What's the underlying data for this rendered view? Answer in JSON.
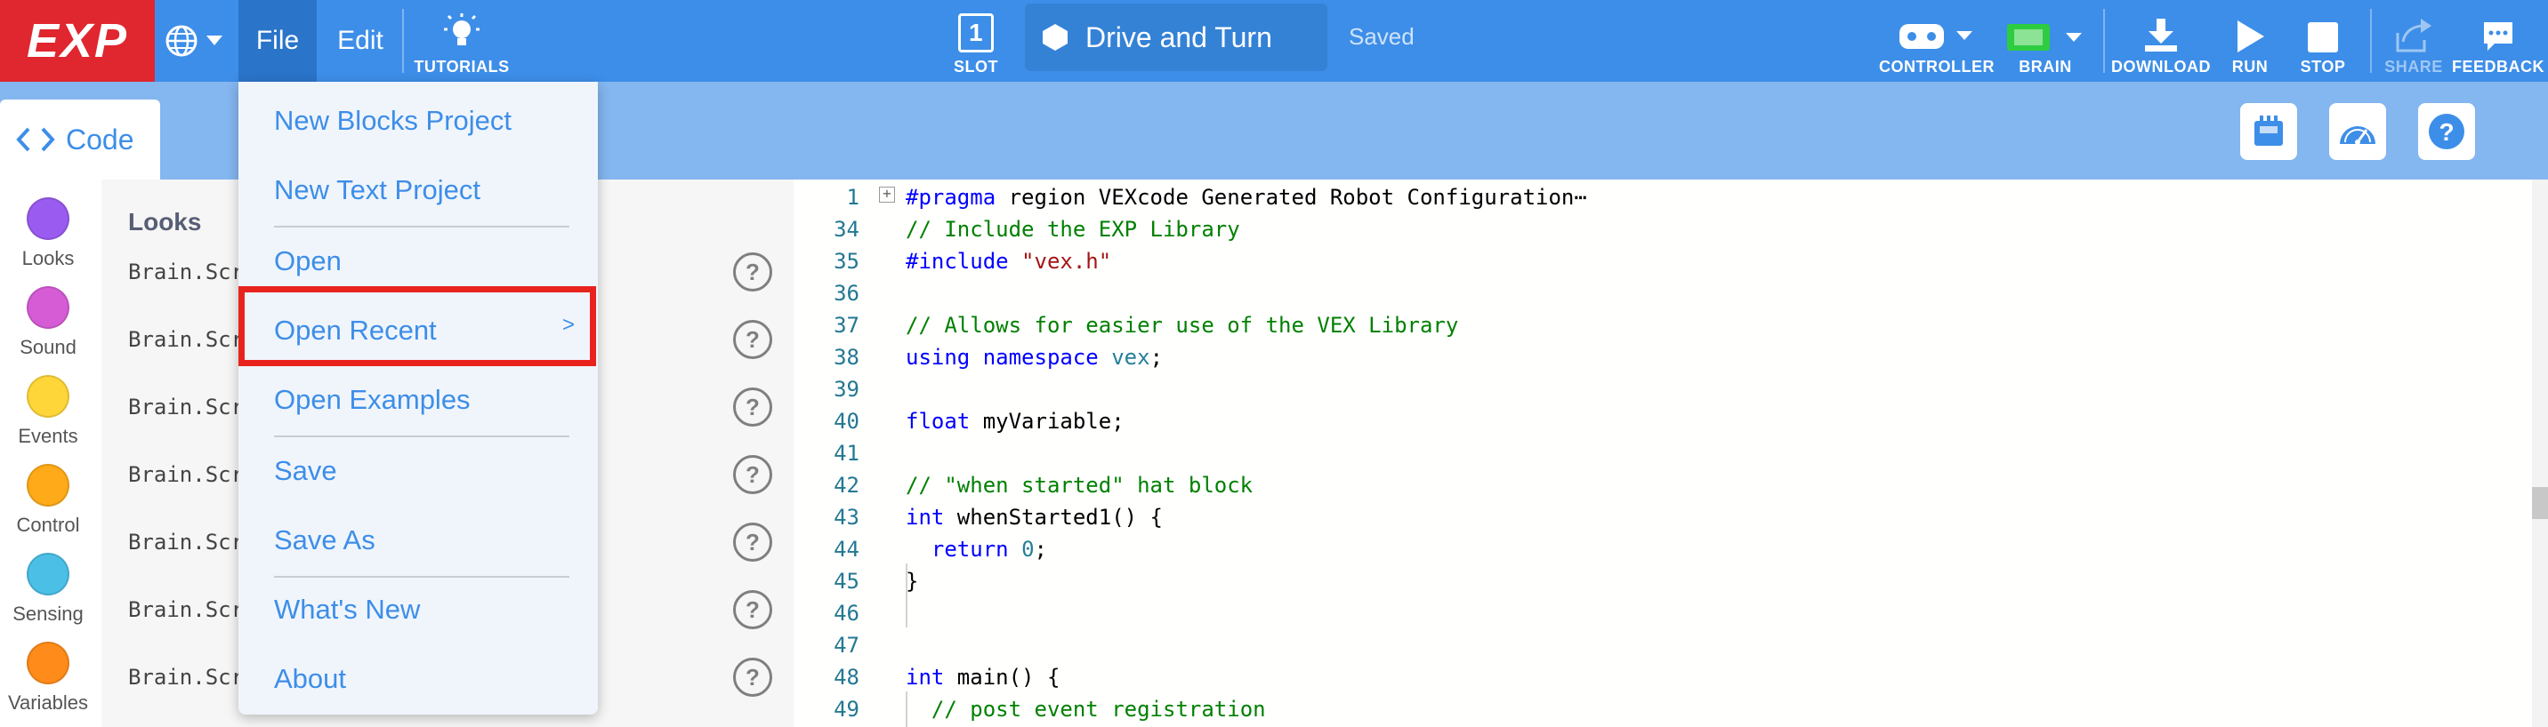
{
  "header": {
    "logo": "EXP",
    "menu": {
      "file": "File",
      "edit": "Edit"
    },
    "tutorials_label": "TUTORIALS",
    "slot": {
      "number": "1",
      "label": "SLOT"
    },
    "project_name": "Drive and Turn",
    "save_status": "Saved",
    "controller_label": "CONTROLLER",
    "brain_label": "BRAIN",
    "download_label": "DOWNLOAD",
    "run_label": "RUN",
    "stop_label": "STOP",
    "share_label": "SHARE",
    "feedback_label": "FEEDBACK"
  },
  "code_tab": {
    "label": "Code"
  },
  "categories": [
    {
      "label": "Looks",
      "color": "#9a5cf0"
    },
    {
      "label": "Sound",
      "color": "#d65cd6"
    },
    {
      "label": "Events",
      "color": "#ffd639"
    },
    {
      "label": "Control",
      "color": "#ffab19"
    },
    {
      "label": "Sensing",
      "color": "#4cbfe6"
    },
    {
      "label": "Variables",
      "color": "#ff8c1a"
    }
  ],
  "palette": {
    "title": "Looks",
    "rows": [
      {
        "text": "Brain.Scr"
      },
      {
        "text": "Brain.Scr"
      },
      {
        "text": "Brain.Scr"
      },
      {
        "text": "Brain.Scr"
      },
      {
        "text": "Brain.Scr"
      },
      {
        "text": "Brain.Scr"
      },
      {
        "text": "Brain.Scr"
      }
    ],
    "help_glyph": "?"
  },
  "file_menu": {
    "items": [
      "New Blocks Project",
      "New Text Project",
      "Open",
      "Open Recent",
      "Open Examples",
      "Save",
      "Save As",
      "What's New",
      "About"
    ],
    "submenu_arrow": ">"
  },
  "editor": {
    "lines": [
      {
        "num": "1",
        "parts": [
          [
            "kw",
            "#pragma"
          ],
          [
            "",
            " region VEXcode Generated Robot Configuration"
          ],
          [
            "",
            "⋯"
          ]
        ]
      },
      {
        "num": "34",
        "parts": [
          [
            "cm",
            "// Include the EXP Library"
          ]
        ]
      },
      {
        "num": "35",
        "parts": [
          [
            "kw",
            "#include"
          ],
          [
            "",
            " "
          ],
          [
            "str",
            "\"vex.h\""
          ]
        ]
      },
      {
        "num": "36",
        "parts": []
      },
      {
        "num": "37",
        "parts": [
          [
            "cm",
            "// Allows for easier use of the VEX Library"
          ]
        ]
      },
      {
        "num": "38",
        "parts": [
          [
            "kw",
            "using"
          ],
          [
            "",
            " "
          ],
          [
            "kw",
            "namespace"
          ],
          [
            "",
            " "
          ],
          [
            "ns",
            "vex"
          ],
          [
            "",
            ";"
          ]
        ]
      },
      {
        "num": "39",
        "parts": []
      },
      {
        "num": "40",
        "parts": [
          [
            "kw",
            "float"
          ],
          [
            "",
            " myVariable;"
          ]
        ]
      },
      {
        "num": "41",
        "parts": []
      },
      {
        "num": "42",
        "parts": [
          [
            "cm",
            "// \"when started\" hat block"
          ]
        ]
      },
      {
        "num": "43",
        "parts": [
          [
            "kw",
            "int"
          ],
          [
            "",
            " whenStarted1() {"
          ]
        ]
      },
      {
        "num": "44",
        "parts": [
          [
            "",
            "  "
          ],
          [
            "kw",
            "return"
          ],
          [
            "",
            " "
          ],
          [
            "ns",
            "0"
          ],
          [
            "",
            ";"
          ]
        ]
      },
      {
        "num": "45",
        "parts": [
          [
            "",
            "}"
          ]
        ]
      },
      {
        "num": "46",
        "parts": []
      },
      {
        "num": "47",
        "parts": []
      },
      {
        "num": "48",
        "parts": [
          [
            "kw",
            "int"
          ],
          [
            "",
            " main() {"
          ]
        ]
      },
      {
        "num": "49",
        "parts": [
          [
            "",
            "  "
          ],
          [
            "cm",
            "// post event registration"
          ]
        ]
      }
    ]
  }
}
